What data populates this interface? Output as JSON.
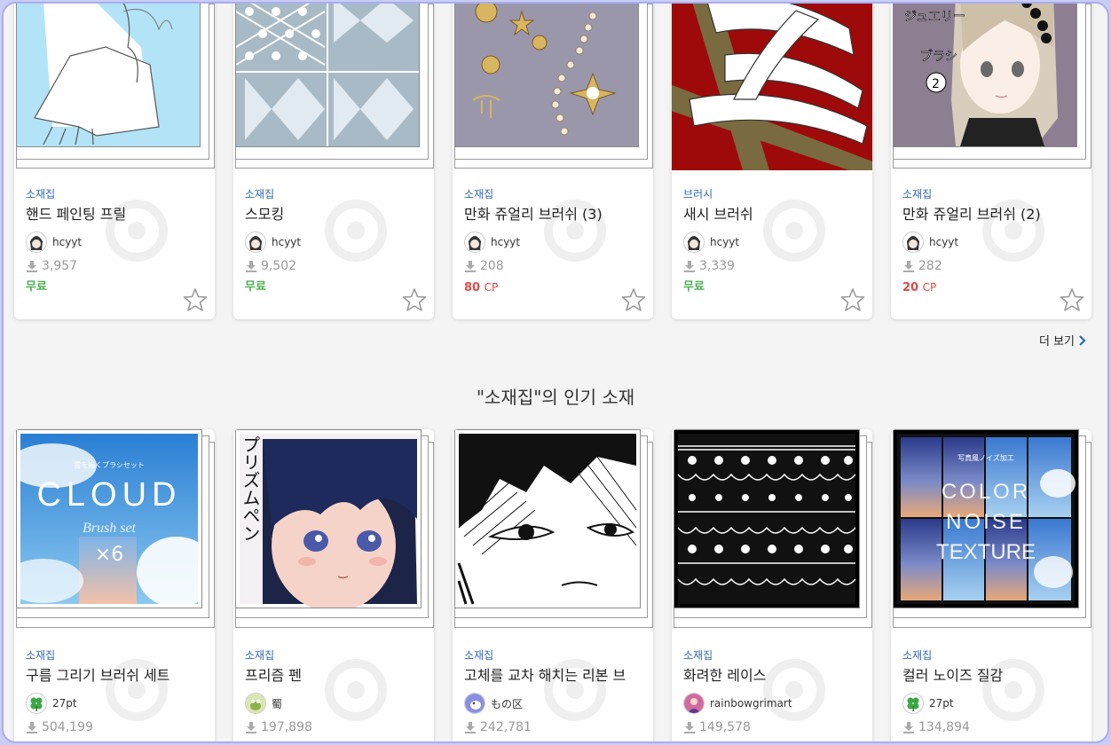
{
  "top_row": [
    {
      "category": "소재집",
      "title": "핸드 페인팅 프릴",
      "author": "hcyyt",
      "downloads": "3,957",
      "price": "무료",
      "price_type": "free",
      "image": "hand-frill",
      "bg": "#b3e3f7"
    },
    {
      "category": "소재집",
      "title": "스모킹",
      "author": "hcyyt",
      "downloads": "9,502",
      "price": "무료",
      "price_type": "free",
      "image": "smocking",
      "bg": "#a9bac7"
    },
    {
      "category": "소재집",
      "title": "만화 쥬얼리 브러쉬 (3)",
      "author": "hcyyt",
      "downloads": "208",
      "price": "80",
      "price_unit": "CP",
      "price_type": "cp",
      "image": "jewelry",
      "bg": "#9b97ab"
    },
    {
      "category": "브러시",
      "title": "새시 브러쉬",
      "author": "hcyyt",
      "downloads": "3,339",
      "price": "무료",
      "price_type": "free",
      "image": "sash",
      "bg": "#9e0a0a"
    },
    {
      "category": "소재집",
      "title": "만화 쥬얼리 브러쉬 (2)",
      "author": "hcyyt",
      "downloads": "282",
      "price": "20",
      "price_unit": "CP",
      "price_type": "cp",
      "image": "jewelry-girl",
      "bg": "#8a7a90"
    }
  ],
  "more_label": "더 보기",
  "section_title": "\"소재집\"의 인기 소재",
  "bottom_row": [
    {
      "category": "소재집",
      "title": "구름 그리기 브러쉬 세트",
      "author": "27pt",
      "downloads": "504,199",
      "image": "cloud",
      "cover_small": "雲を描くブラシセット",
      "cover_big": "CLOUD",
      "cover_script": "Brush set",
      "cover_count": "×6"
    },
    {
      "category": "소재집",
      "title": "프리즘 펜",
      "author": "蜀",
      "downloads": "197,898",
      "image": "prism",
      "cover_big": "プリズムペン"
    },
    {
      "category": "소재집",
      "title": "고체를 교차 해치는 리본 브",
      "author": "もの区",
      "downloads": "242,781",
      "image": "hatching"
    },
    {
      "category": "소재집",
      "title": "화려한 레이스",
      "author": "rainbowgrimart",
      "downloads": "149,578",
      "image": "lace"
    },
    {
      "category": "소재집",
      "title": "컬러 노이즈 질감",
      "author": "27pt",
      "downloads": "134,894",
      "image": "color-noise",
      "cover_small": "写真風ノイズ加工",
      "cover_lines": [
        "COLOR",
        "NOISE",
        "TEXTURE"
      ]
    }
  ]
}
